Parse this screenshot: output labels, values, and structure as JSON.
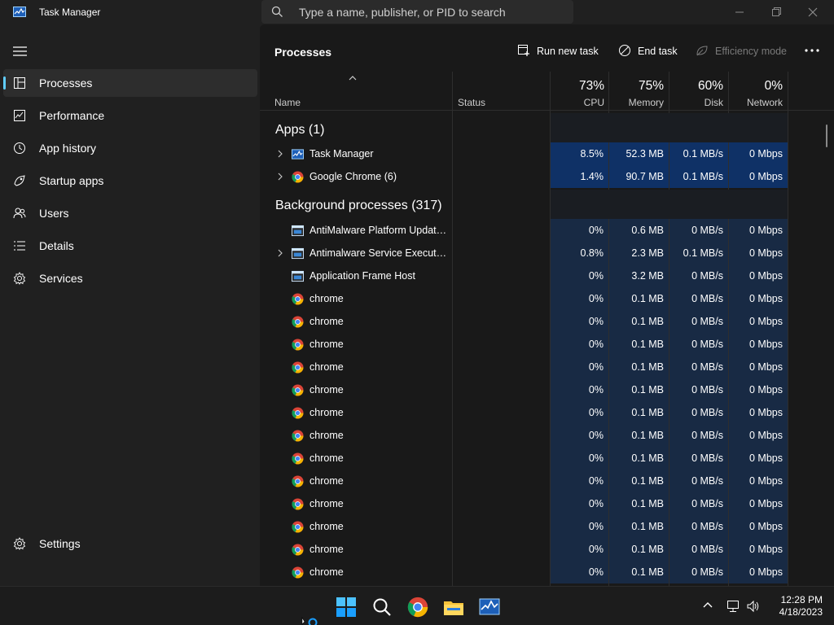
{
  "window": {
    "title": "Task Manager",
    "search_placeholder": "Type a name, publisher, or PID to search"
  },
  "sidebar": {
    "items": [
      {
        "label": "Processes",
        "icon": "processes-icon",
        "active": true
      },
      {
        "label": "Performance",
        "icon": "performance-icon"
      },
      {
        "label": "App history",
        "icon": "app-history-icon"
      },
      {
        "label": "Startup apps",
        "icon": "startup-apps-icon"
      },
      {
        "label": "Users",
        "icon": "users-icon"
      },
      {
        "label": "Details",
        "icon": "details-icon"
      },
      {
        "label": "Services",
        "icon": "services-icon"
      }
    ],
    "settings_label": "Settings"
  },
  "toolbar": {
    "title": "Processes",
    "run_new_task": "Run new task",
    "end_task": "End task",
    "efficiency_mode": "Efficiency mode"
  },
  "columns": {
    "name": "Name",
    "status": "Status",
    "cpu": {
      "pct": "73%",
      "label": "CPU"
    },
    "memory": {
      "pct": "75%",
      "label": "Memory"
    },
    "disk": {
      "pct": "60%",
      "label": "Disk"
    },
    "network": {
      "pct": "0%",
      "label": "Network"
    }
  },
  "groups": {
    "apps": "Apps (1)",
    "background": "Background processes (317)"
  },
  "apps": [
    {
      "name": "Task Manager",
      "icon": "task-manager-icon",
      "cpu": "8.5%",
      "memory": "52.3 MB",
      "disk": "0.1 MB/s",
      "network": "0 Mbps"
    },
    {
      "name": "Google Chrome (6)",
      "icon": "chrome-icon",
      "cpu": "1.4%",
      "memory": "90.7 MB",
      "disk": "0.1 MB/s",
      "network": "0 Mbps"
    }
  ],
  "background": [
    {
      "name": "AntiMalware Platform Update ...",
      "icon": "service-icon",
      "expandable": false,
      "cpu": "0%",
      "memory": "0.6 MB",
      "disk": "0 MB/s",
      "network": "0 Mbps"
    },
    {
      "name": "Antimalware Service Executable",
      "icon": "service-icon",
      "expandable": true,
      "cpu": "0.8%",
      "memory": "2.3 MB",
      "disk": "0.1 MB/s",
      "network": "0 Mbps"
    },
    {
      "name": "Application Frame Host",
      "icon": "service-icon",
      "expandable": false,
      "cpu": "0%",
      "memory": "3.2 MB",
      "disk": "0 MB/s",
      "network": "0 Mbps"
    },
    {
      "name": "chrome",
      "icon": "chrome-icon",
      "expandable": false,
      "cpu": "0%",
      "memory": "0.1 MB",
      "disk": "0 MB/s",
      "network": "0 Mbps"
    },
    {
      "name": "chrome",
      "icon": "chrome-icon",
      "expandable": false,
      "cpu": "0%",
      "memory": "0.1 MB",
      "disk": "0 MB/s",
      "network": "0 Mbps"
    },
    {
      "name": "chrome",
      "icon": "chrome-icon",
      "expandable": false,
      "cpu": "0%",
      "memory": "0.1 MB",
      "disk": "0 MB/s",
      "network": "0 Mbps"
    },
    {
      "name": "chrome",
      "icon": "chrome-icon",
      "expandable": false,
      "cpu": "0%",
      "memory": "0.1 MB",
      "disk": "0 MB/s",
      "network": "0 Mbps"
    },
    {
      "name": "chrome",
      "icon": "chrome-icon",
      "expandable": false,
      "cpu": "0%",
      "memory": "0.1 MB",
      "disk": "0 MB/s",
      "network": "0 Mbps"
    },
    {
      "name": "chrome",
      "icon": "chrome-icon",
      "expandable": false,
      "cpu": "0%",
      "memory": "0.1 MB",
      "disk": "0 MB/s",
      "network": "0 Mbps"
    },
    {
      "name": "chrome",
      "icon": "chrome-icon",
      "expandable": false,
      "cpu": "0%",
      "memory": "0.1 MB",
      "disk": "0 MB/s",
      "network": "0 Mbps"
    },
    {
      "name": "chrome",
      "icon": "chrome-icon",
      "expandable": false,
      "cpu": "0%",
      "memory": "0.1 MB",
      "disk": "0 MB/s",
      "network": "0 Mbps"
    },
    {
      "name": "chrome",
      "icon": "chrome-icon",
      "expandable": false,
      "cpu": "0%",
      "memory": "0.1 MB",
      "disk": "0 MB/s",
      "network": "0 Mbps"
    },
    {
      "name": "chrome",
      "icon": "chrome-icon",
      "expandable": false,
      "cpu": "0%",
      "memory": "0.1 MB",
      "disk": "0 MB/s",
      "network": "0 Mbps"
    },
    {
      "name": "chrome",
      "icon": "chrome-icon",
      "expandable": false,
      "cpu": "0%",
      "memory": "0.1 MB",
      "disk": "0 MB/s",
      "network": "0 Mbps"
    },
    {
      "name": "chrome",
      "icon": "chrome-icon",
      "expandable": false,
      "cpu": "0%",
      "memory": "0.1 MB",
      "disk": "0 MB/s",
      "network": "0 Mbps"
    },
    {
      "name": "chrome",
      "icon": "chrome-icon",
      "expandable": false,
      "cpu": "0%",
      "memory": "0.1 MB",
      "disk": "0 MB/s",
      "network": "0 Mbps"
    }
  ],
  "taskbar": {
    "icons": [
      "start-icon",
      "search-icon",
      "chrome-icon",
      "file-explorer-icon",
      "task-manager-icon"
    ],
    "time": "12:28 PM",
    "date": "4/18/2023"
  },
  "colors": {
    "accent": "#60cdff",
    "heat_high": "#0f3166",
    "heat_low": "#182a44"
  }
}
